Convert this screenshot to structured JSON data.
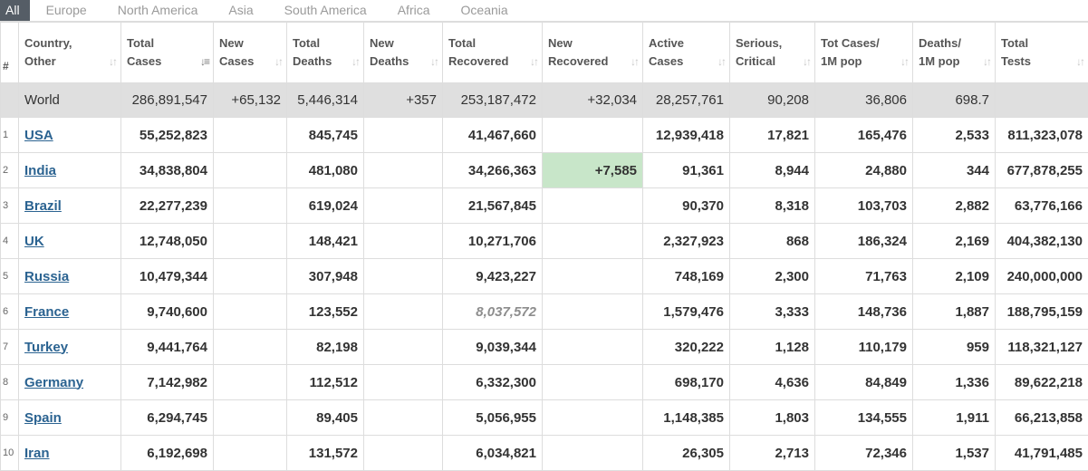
{
  "tabs": [
    {
      "label": "All",
      "active": true
    },
    {
      "label": "Europe"
    },
    {
      "label": "North America"
    },
    {
      "label": "Asia"
    },
    {
      "label": "South America"
    },
    {
      "label": "Africa"
    },
    {
      "label": "Oceania"
    }
  ],
  "headers": [
    {
      "l1": "#",
      "l2": ""
    },
    {
      "l1": "Country,",
      "l2": "Other"
    },
    {
      "l1": "Total",
      "l2": "Cases"
    },
    {
      "l1": "New",
      "l2": "Cases"
    },
    {
      "l1": "Total",
      "l2": "Deaths"
    },
    {
      "l1": "New",
      "l2": "Deaths"
    },
    {
      "l1": "Total",
      "l2": "Recovered"
    },
    {
      "l1": "New",
      "l2": "Recovered"
    },
    {
      "l1": "Active",
      "l2": "Cases"
    },
    {
      "l1": "Serious,",
      "l2": "Critical"
    },
    {
      "l1": "Tot Cases/",
      "l2": "1M pop"
    },
    {
      "l1": "Deaths/",
      "l2": "1M pop"
    },
    {
      "l1": "Total",
      "l2": "Tests"
    }
  ],
  "sort_icon": "sort-arrows-icon",
  "world": {
    "country": "World",
    "total_cases": "286,891,547",
    "new_cases": "+65,132",
    "total_deaths": "5,446,314",
    "new_deaths": "+357",
    "total_recovered": "253,187,472",
    "new_recovered": "+32,034",
    "active_cases": "28,257,761",
    "serious": "90,208",
    "cases_per_m": "36,806",
    "deaths_per_m": "698.7",
    "total_tests": ""
  },
  "rows": [
    {
      "idx": "1",
      "country": "USA",
      "total_cases": "55,252,823",
      "new_cases": "",
      "total_deaths": "845,745",
      "new_deaths": "",
      "total_recovered": "41,467,660",
      "new_recovered": "",
      "active_cases": "12,939,418",
      "serious": "17,821",
      "cases_per_m": "165,476",
      "deaths_per_m": "2,533",
      "total_tests": "811,323,078"
    },
    {
      "idx": "2",
      "country": "India",
      "total_cases": "34,838,804",
      "new_cases": "",
      "total_deaths": "481,080",
      "new_deaths": "",
      "total_recovered": "34,266,363",
      "new_recovered": "+7,585",
      "active_cases": "91,361",
      "serious": "8,944",
      "cases_per_m": "24,880",
      "deaths_per_m": "344",
      "total_tests": "677,878,255"
    },
    {
      "idx": "3",
      "country": "Brazil",
      "total_cases": "22,277,239",
      "new_cases": "",
      "total_deaths": "619,024",
      "new_deaths": "",
      "total_recovered": "21,567,845",
      "new_recovered": "",
      "active_cases": "90,370",
      "serious": "8,318",
      "cases_per_m": "103,703",
      "deaths_per_m": "2,882",
      "total_tests": "63,776,166"
    },
    {
      "idx": "4",
      "country": "UK",
      "total_cases": "12,748,050",
      "new_cases": "",
      "total_deaths": "148,421",
      "new_deaths": "",
      "total_recovered": "10,271,706",
      "new_recovered": "",
      "active_cases": "2,327,923",
      "serious": "868",
      "cases_per_m": "186,324",
      "deaths_per_m": "2,169",
      "total_tests": "404,382,130"
    },
    {
      "idx": "5",
      "country": "Russia",
      "total_cases": "10,479,344",
      "new_cases": "",
      "total_deaths": "307,948",
      "new_deaths": "",
      "total_recovered": "9,423,227",
      "new_recovered": "",
      "active_cases": "748,169",
      "serious": "2,300",
      "cases_per_m": "71,763",
      "deaths_per_m": "2,109",
      "total_tests": "240,000,000"
    },
    {
      "idx": "6",
      "country": "France",
      "total_cases": "9,740,600",
      "new_cases": "",
      "total_deaths": "123,552",
      "new_deaths": "",
      "total_recovered": "8,037,572",
      "new_recovered": "",
      "active_cases": "1,579,476",
      "serious": "3,333",
      "cases_per_m": "148,736",
      "deaths_per_m": "1,887",
      "total_tests": "188,795,159"
    },
    {
      "idx": "7",
      "country": "Turkey",
      "total_cases": "9,441,764",
      "new_cases": "",
      "total_deaths": "82,198",
      "new_deaths": "",
      "total_recovered": "9,039,344",
      "new_recovered": "",
      "active_cases": "320,222",
      "serious": "1,128",
      "cases_per_m": "110,179",
      "deaths_per_m": "959",
      "total_tests": "118,321,127"
    },
    {
      "idx": "8",
      "country": "Germany",
      "total_cases": "7,142,982",
      "new_cases": "",
      "total_deaths": "112,512",
      "new_deaths": "",
      "total_recovered": "6,332,300",
      "new_recovered": "",
      "active_cases": "698,170",
      "serious": "4,636",
      "cases_per_m": "84,849",
      "deaths_per_m": "1,336",
      "total_tests": "89,622,218"
    },
    {
      "idx": "9",
      "country": "Spain",
      "total_cases": "6,294,745",
      "new_cases": "",
      "total_deaths": "89,405",
      "new_deaths": "",
      "total_recovered": "5,056,955",
      "new_recovered": "",
      "active_cases": "1,148,385",
      "serious": "1,803",
      "cases_per_m": "134,555",
      "deaths_per_m": "1,911",
      "total_tests": "66,213,858"
    },
    {
      "idx": "10",
      "country": "Iran",
      "total_cases": "6,192,698",
      "new_cases": "",
      "total_deaths": "131,572",
      "new_deaths": "",
      "total_recovered": "6,034,821",
      "new_recovered": "",
      "active_cases": "26,305",
      "serious": "2,713",
      "cases_per_m": "72,346",
      "deaths_per_m": "1,537",
      "total_tests": "41,791,485"
    }
  ],
  "colors": {
    "highlight_new_recovered": "#c8e6c9",
    "world_row_bg": "#dfdfdf",
    "country_link": "#2b6391",
    "active_tab_bg": "#555d66"
  }
}
